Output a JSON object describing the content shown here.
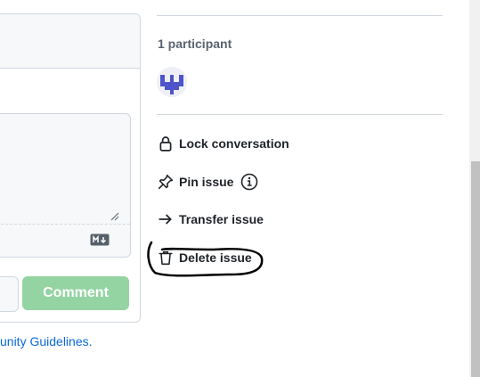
{
  "sidebar": {
    "participants_title": "1 participant",
    "actions": {
      "lock": "Lock conversation",
      "pin": "Pin issue",
      "transfer": "Transfer issue",
      "delete": "Delete issue"
    }
  },
  "form": {
    "comment_button": "Comment",
    "guidelines_link": "unity Guidelines."
  },
  "icons": {
    "lock": "lock-icon",
    "pin": "pin-icon",
    "info": "info-icon",
    "transfer": "arrow-right-icon",
    "delete": "trash-icon",
    "markdown": "markdown-icon"
  },
  "colors": {
    "comment_button_disabled": "#94d3a2",
    "link": "#0969da",
    "avatar_accent": "#4d55c9",
    "border": "#d0d7de"
  }
}
